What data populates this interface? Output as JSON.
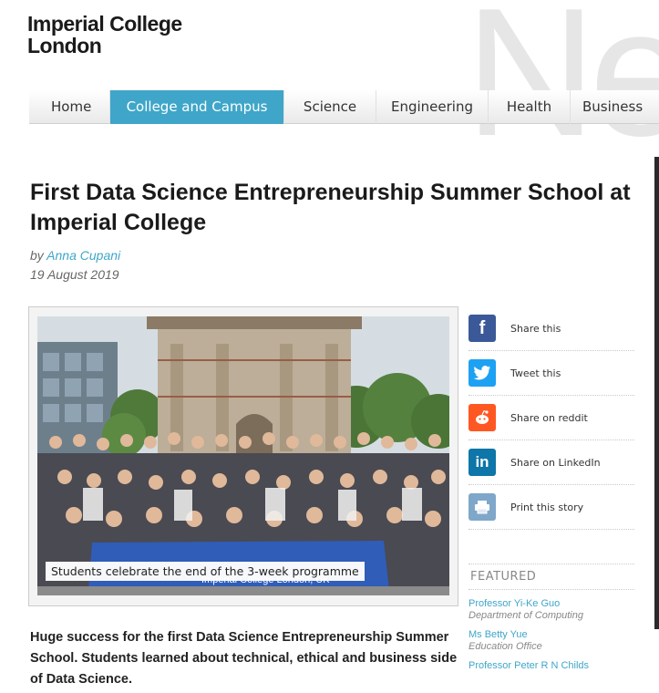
{
  "brand": {
    "logo_line1": "Imperial College",
    "logo_line2": "London",
    "watermark": "Ne"
  },
  "nav": {
    "items": [
      {
        "label": "Home"
      },
      {
        "label": "College and Campus",
        "active": true
      },
      {
        "label": "Science"
      },
      {
        "label": "Engineering"
      },
      {
        "label": "Health"
      },
      {
        "label": "Business"
      }
    ]
  },
  "article": {
    "title": "First Data Science Entrepreneurship Summer School at Imperial College",
    "by_prefix": "by",
    "author": "Anna Cupani",
    "date": "19 August 2019",
    "photo_caption": "Students celebrate the end of the 3-week programme",
    "banner_text": "Imperial College London, UK",
    "summary": "Huge success for the first Data Science Entrepreneurship Summer School. Students learned about technical, ethical and business side of Data Science."
  },
  "share": {
    "items": [
      {
        "label": "Share this",
        "icon": "facebook-icon",
        "glyph": "f",
        "color": "#3b5998"
      },
      {
        "label": "Tweet this",
        "icon": "twitter-icon",
        "glyph": "t",
        "color": "#1da1f2"
      },
      {
        "label": "Share on reddit",
        "icon": "reddit-icon",
        "glyph": "r",
        "color": "#ff5722"
      },
      {
        "label": "Share on LinkedIn",
        "icon": "linkedin-icon",
        "glyph": "in",
        "color": "#0e76a8"
      },
      {
        "label": "Print this story",
        "icon": "print-icon",
        "glyph": "⎙",
        "color": "#7fa7c9"
      }
    ]
  },
  "featured": {
    "heading": "FEATURED",
    "people": [
      {
        "name": "Professor Yi-Ke Guo",
        "dept": "Department of Computing"
      },
      {
        "name": "Ms Betty Yue",
        "dept": "Education Office"
      },
      {
        "name": "Professor Peter R N Childs",
        "dept": ""
      }
    ]
  },
  "colors": {
    "accent": "#3fa6c9",
    "text": "#222222",
    "muted": "#666666"
  }
}
